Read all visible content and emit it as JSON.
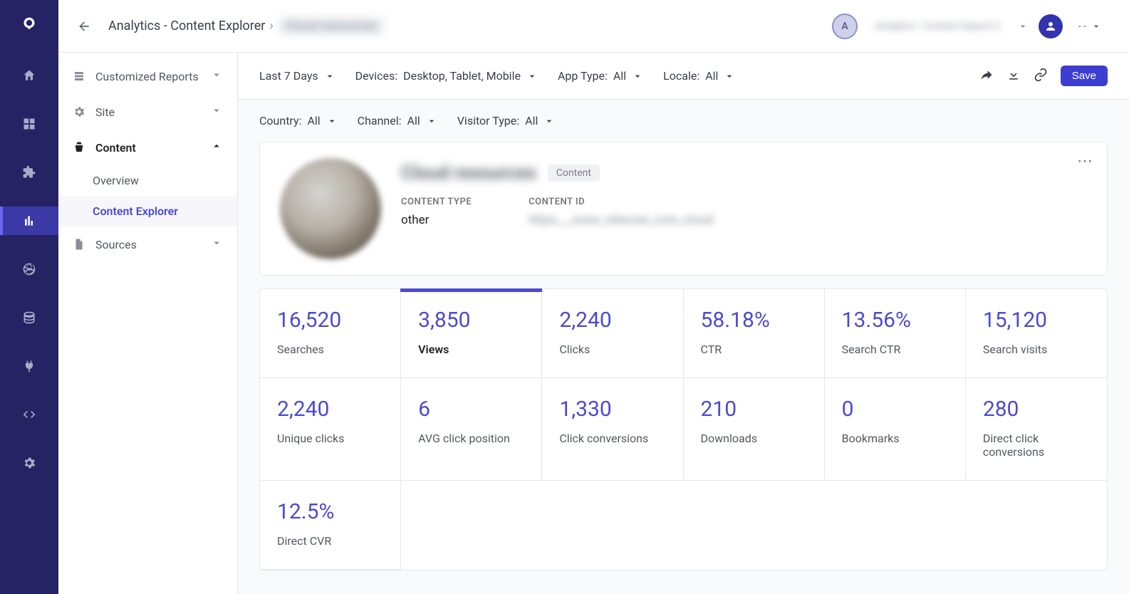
{
  "header": {
    "breadcrumb_root": "Analytics - Content Explorer",
    "breadcrumb_leaf": "Cloud resources",
    "avatar_initial": "A",
    "top_blur_text": "Analytics • Content Search  2",
    "range_dd": "- -"
  },
  "sidebar": {
    "items": [
      {
        "label": "Customized Reports"
      },
      {
        "label": "Site"
      },
      {
        "label": "Content"
      },
      {
        "label": "Sources"
      }
    ],
    "content_subs": [
      {
        "label": "Overview"
      },
      {
        "label": "Content Explorer"
      }
    ]
  },
  "toolbar": {
    "time_range": "Last 7 Days",
    "devices_label": "Devices:",
    "devices_value": "Desktop, Tablet, Mobile",
    "app_type_label": "App Type:",
    "app_type_value": "All",
    "locale_label": "Locale:",
    "locale_value": "All",
    "save_label": "Save"
  },
  "filters": {
    "country_label": "Country:",
    "country_value": "All",
    "channel_label": "Channel:",
    "channel_value": "All",
    "visitor_label": "Visitor Type:",
    "visitor_value": "All"
  },
  "content": {
    "title": "Cloud resources",
    "tag": "Content",
    "type_label": "CONTENT TYPE",
    "type_value": "other",
    "id_label": "CONTENT ID",
    "id_value": "https___www_sitecore_com_cloud"
  },
  "metrics": [
    {
      "value": "16,520",
      "label": "Searches"
    },
    {
      "value": "3,850",
      "label": "Views",
      "active": true
    },
    {
      "value": "2,240",
      "label": "Clicks"
    },
    {
      "value": "58.18%",
      "label": "CTR"
    },
    {
      "value": "13.56%",
      "label": "Search CTR"
    },
    {
      "value": "15,120",
      "label": "Search visits"
    },
    {
      "value": "2,240",
      "label": "Unique clicks"
    },
    {
      "value": "6",
      "label": "AVG click position"
    },
    {
      "value": "1,330",
      "label": "Click conversions"
    },
    {
      "value": "210",
      "label": "Downloads"
    },
    {
      "value": "0",
      "label": "Bookmarks"
    },
    {
      "value": "280",
      "label": "Direct click conversions"
    },
    {
      "value": "12.5%",
      "label": "Direct CVR"
    }
  ]
}
